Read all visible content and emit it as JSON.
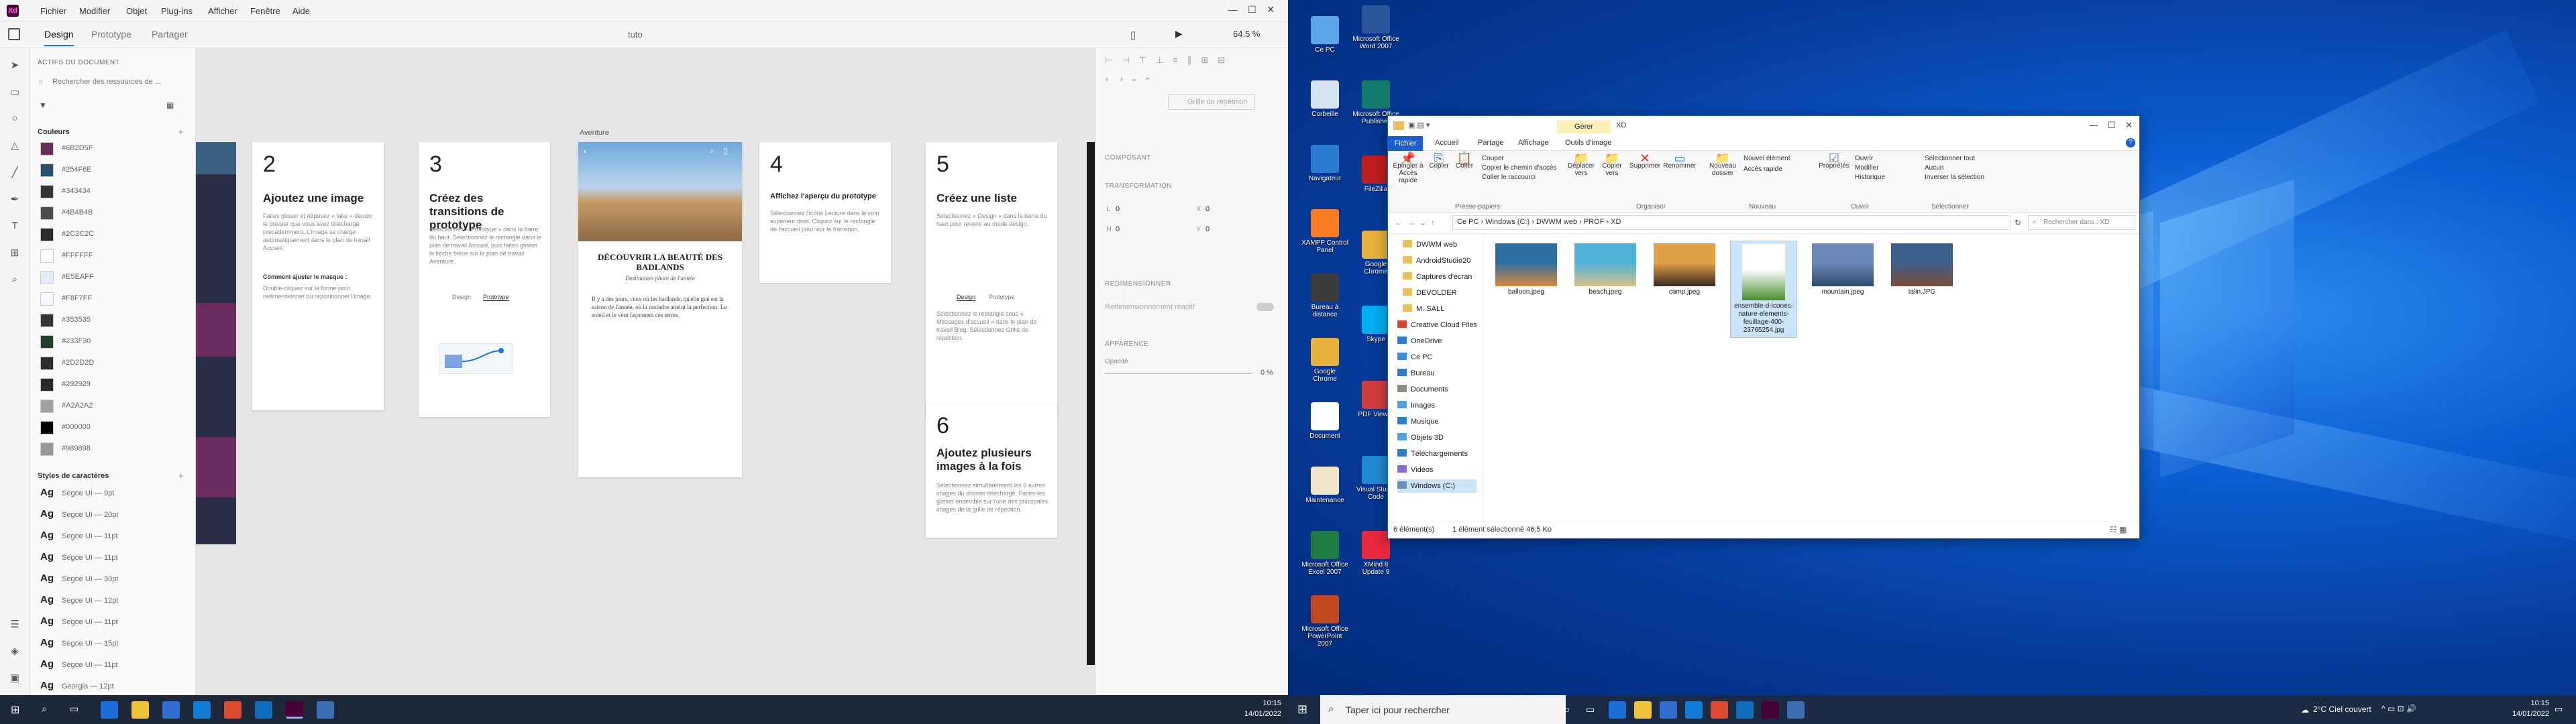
{
  "xd": {
    "menu": [
      "Fichier",
      "Modifier",
      "Objet",
      "Plug-ins",
      "Afficher",
      "Fenêtre",
      "Aide"
    ],
    "tabs": [
      "Design",
      "Prototype",
      "Partager"
    ],
    "doc_title": "tuto",
    "zoom": "64,5 %",
    "assets": {
      "header": "ACTIFS DU DOCUMENT",
      "search_placeholder": "Rechercher des ressources de ...",
      "colors_title": "Couleurs",
      "colors": [
        {
          "hex": "#6B2D5F",
          "label": "#6B2D5F"
        },
        {
          "hex": "#254F6E",
          "label": "#254F6E"
        },
        {
          "hex": "#343434",
          "label": "#343434"
        },
        {
          "hex": "#4B4B4B",
          "label": "#4B4B4B"
        },
        {
          "hex": "#2C2C2C",
          "label": "#2C2C2C"
        },
        {
          "hex": "#FFFFFF",
          "label": "#FFFFFF"
        },
        {
          "hex": "#E5EAFF",
          "label": "#E5EAFF"
        },
        {
          "hex": "#F8F7FF",
          "label": "#F8F7FF"
        },
        {
          "hex": "#353535",
          "label": "#353535"
        },
        {
          "hex": "#233F30",
          "label": "#233F30"
        },
        {
          "hex": "#2D2D2D",
          "label": "#2D2D2D"
        },
        {
          "hex": "#292929",
          "label": "#292929"
        },
        {
          "hex": "#A2A2A2",
          "label": "#A2A2A2"
        },
        {
          "hex": "#000000",
          "label": "#000000"
        },
        {
          "hex": "#989898",
          "label": "#989898"
        }
      ],
      "charstyles_title": "Styles de caractères",
      "charstyles": [
        {
          "ag": "Ag",
          "label": "Segoe UI — 9pt"
        },
        {
          "ag": "Ag",
          "label": "Segoe UI — 20pt"
        },
        {
          "ag": "Ag",
          "label": "Segoe UI — 11pt"
        },
        {
          "ag": "Ag",
          "label": "Segoe UI — 11pt"
        },
        {
          "ag": "Ag",
          "label": "Segoe UI — 30pt"
        },
        {
          "ag": "Ag",
          "label": "Segoe UI — 12pt"
        },
        {
          "ag": "Ag",
          "label": "Segoe UI — 11pt"
        },
        {
          "ag": "Ag",
          "label": "Segoe UI — 15pt"
        },
        {
          "ag": "Ag",
          "label": "Segoe UI — 11pt"
        },
        {
          "ag": "Ag",
          "label": "Georgia — 12pt"
        },
        {
          "ag": "Ag",
          "label": "Segoe UI — 11pt"
        }
      ]
    },
    "canvas": {
      "artboard_label": "Aventure",
      "cards": [
        {
          "num": "2",
          "title": "Ajoutez une image",
          "text": "Faites glisser et déposez « lake » depuis le dossier que vous avez téléchargé précédemment. L'image se charge automatiquement dans le plan de travail Accueil.",
          "sub": "Comment ajuster le masque :",
          "sub_text": "Double-cliquez sur la forme pour redimensionner ou repositionner l'image."
        },
        {
          "num": "3",
          "title": "Créez des transitions de prototype",
          "text": "Sélectionnez « Prototype » dans la barre du haut. Sélectionnez le rectangle dans le plan de travail Accueil, puis faites glisser la flèche bleue sur le plan de travail Aventure.",
          "tab1": "Design",
          "tab2": "Prototype"
        },
        {
          "num": "4",
          "title": "Affichez l'aperçu du prototype",
          "text": "Sélectionnez l'icône Lecture dans le coin supérieur droit. Cliquez sur le rectangle de l'accueil pour voir la transition."
        },
        {
          "num": "5",
          "title": "Créez une liste",
          "text": "Sélectionnez « Design » dans la barre du haut pour revenir au mode design.",
          "tab1": "Design",
          "tab2": "Prototype",
          "text2": "Sélectionnez le rectangle sous « Messages d'accueil » dans le plan de travail Blog. Sélectionnez Grille de répétition."
        },
        {
          "num": "6",
          "title": "Ajoutez plusieurs images à la fois",
          "text": "Sélectionnez simultanément les 6 autres images du dossier téléchargé. Faites-les glisser ensemble sur l'une des principales images de la grille de répétition."
        }
      ],
      "phone": {
        "heading": "DÉCOUVRIR LA BEAUTÉ DES BADLANDS",
        "sub": "Destination phare de l'année",
        "body": "Il y a des jours, ceux où les badlands, qu'elle gué est la saison de l'année, où la moindre atteint la perfection. Le soleil et le vent façonnent ces terres."
      }
    },
    "props": {
      "repeat_grid": "Grille de répétition",
      "component": "COMPOSANT",
      "transform": "TRANSFORMATION",
      "w_label": "L",
      "w": "0",
      "x_label": "X",
      "x": "0",
      "h_label": "H",
      "h": "0",
      "y_label": "Y",
      "y": "0",
      "responsive": "REDIMENSIONNER",
      "responsive_toggle": "Redimensionnement réactif",
      "appearance": "APPARENCE",
      "opacity_label": "Opacité",
      "opacity": "0 %"
    },
    "taskbar_time": "10:15",
    "taskbar_date": "14/01/2022"
  },
  "desktop": {
    "icons": [
      {
        "label": "Ce PC",
        "color": "#5aa6e8"
      },
      {
        "label": "Corbeille",
        "color": "#d7e3ee"
      },
      {
        "label": "Navigateur",
        "color": "#2b7cd3"
      },
      {
        "label": "XAMPP Control Panel",
        "color": "#fb7a24"
      },
      {
        "label": "Bureau à distance",
        "color": "#3b3b3b"
      },
      {
        "label": "Google Chrome",
        "color": "#e8b23c"
      },
      {
        "label": "Document",
        "color": "#ffffff"
      },
      {
        "label": "Maintenance",
        "color": "#f2e6c8"
      },
      {
        "label": "Microsoft Office Excel 2007",
        "color": "#1f7a44"
      },
      {
        "label": "Microsoft Office PowerPoint 2007",
        "color": "#c2481f"
      },
      {
        "label": "Microsoft Office Word 2007",
        "color": "#2b579a"
      },
      {
        "label": "Microsoft Office Publisher",
        "color": "#0f7b6c"
      },
      {
        "label": "FileZilla",
        "color": "#bf1e1e"
      },
      {
        "label": "Google Chrome",
        "color": "#e8b23c"
      },
      {
        "label": "Skype",
        "color": "#00aff0"
      },
      {
        "label": "PDF Viewer",
        "color": "#d13b3b"
      },
      {
        "label": "Visual Studio Code",
        "color": "#1f8ad2"
      },
      {
        "label": "XMind 8 Update 9",
        "color": "#e8283c"
      }
    ]
  },
  "explorer": {
    "title": "XD",
    "context_tab": "Gérer",
    "ribbon_tabs": [
      "Fichier",
      "Accueil",
      "Partage",
      "Affichage",
      "Outils d'image"
    ],
    "ribbon": {
      "pin": "Épingler à Accès rapide",
      "copy": "Copier",
      "paste": "Coller",
      "cut": "Couper",
      "copy_path": "Copier le chemin d'accès",
      "paste_shortcut": "Coller le raccourci",
      "move_to": "Déplacer vers",
      "copy_to": "Copier vers",
      "delete": "Supprimer",
      "rename": "Renommer",
      "new_folder": "Nouveau dossier",
      "new_item": "Nouvel élément",
      "easy_access": "Accès rapide",
      "properties": "Propriétés",
      "open": "Ouvrir",
      "edit": "Modifier",
      "history": "Historique",
      "select_all": "Sélectionner tout",
      "select_none": "Aucun",
      "invert": "Inverser la sélection",
      "groups": [
        "Presse-papiers",
        "Organiser",
        "Nouveau",
        "Ouvrir",
        "Sélectionner"
      ]
    },
    "breadcrumb": [
      "Ce PC",
      "Windows (C:)",
      "DWWM web",
      "PROF",
      "XD"
    ],
    "search_placeholder": "Rechercher dans : XD",
    "nav": [
      {
        "label": "DWWM web",
        "color": "#e8c15a"
      },
      {
        "label": "AndroidStudio20",
        "color": "#e8c15a"
      },
      {
        "label": "Captures d'écran",
        "color": "#e8c15a"
      },
      {
        "label": "DEVOLDER",
        "color": "#e8c15a"
      },
      {
        "label": "M. SALL",
        "color": "#e8c15a"
      },
      {
        "label": "Creative Cloud Files",
        "color": "#d9422b"
      },
      {
        "label": "OneDrive",
        "color": "#2b7cd3"
      },
      {
        "label": "Ce PC",
        "color": "#3c8de0"
      },
      {
        "label": "Bureau",
        "color": "#2f7fd1"
      },
      {
        "label": "Documents",
        "color": "#8c8c8c"
      },
      {
        "label": "Images",
        "color": "#57a0dc"
      },
      {
        "label": "Musique",
        "color": "#2f7fd1"
      },
      {
        "label": "Objets 3D",
        "color": "#57a0dc"
      },
      {
        "label": "Téléchargements",
        "color": "#2f7fd1"
      },
      {
        "label": "Vidéos",
        "color": "#8c6bd6"
      },
      {
        "label": "Windows (C:)",
        "color": "#6d8fb5"
      }
    ],
    "files": [
      {
        "name": "balloon.jpeg",
        "c1": "#2d6fa3",
        "c2": "#d9893a"
      },
      {
        "name": "beach.jpeg",
        "c1": "#4fb3d9",
        "c2": "#d6c28a"
      },
      {
        "name": "camp.jpeg",
        "c1": "#e0a146",
        "c2": "#3b2a1c"
      },
      {
        "name": "ensemble-d-icones-nature-elements-feuillage-400-23765254.jpg",
        "c1": "#ffffff",
        "c2": "#4c8f2f"
      },
      {
        "name": "mountain.jpeg",
        "c1": "#6a88b8",
        "c2": "#2f4a6e"
      },
      {
        "name": "talin.JPG",
        "c1": "#3a5f8a",
        "c2": "#7a4d35"
      }
    ],
    "status_count": "6 élément(s)",
    "status_selected": "1 élément sélectionné  46,5 Ko"
  },
  "taskbar_right": {
    "search_placeholder": "Taper ici pour rechercher",
    "weather": "2°C  Ciel couvert",
    "time": "10:15",
    "date": "14/01/2022"
  }
}
